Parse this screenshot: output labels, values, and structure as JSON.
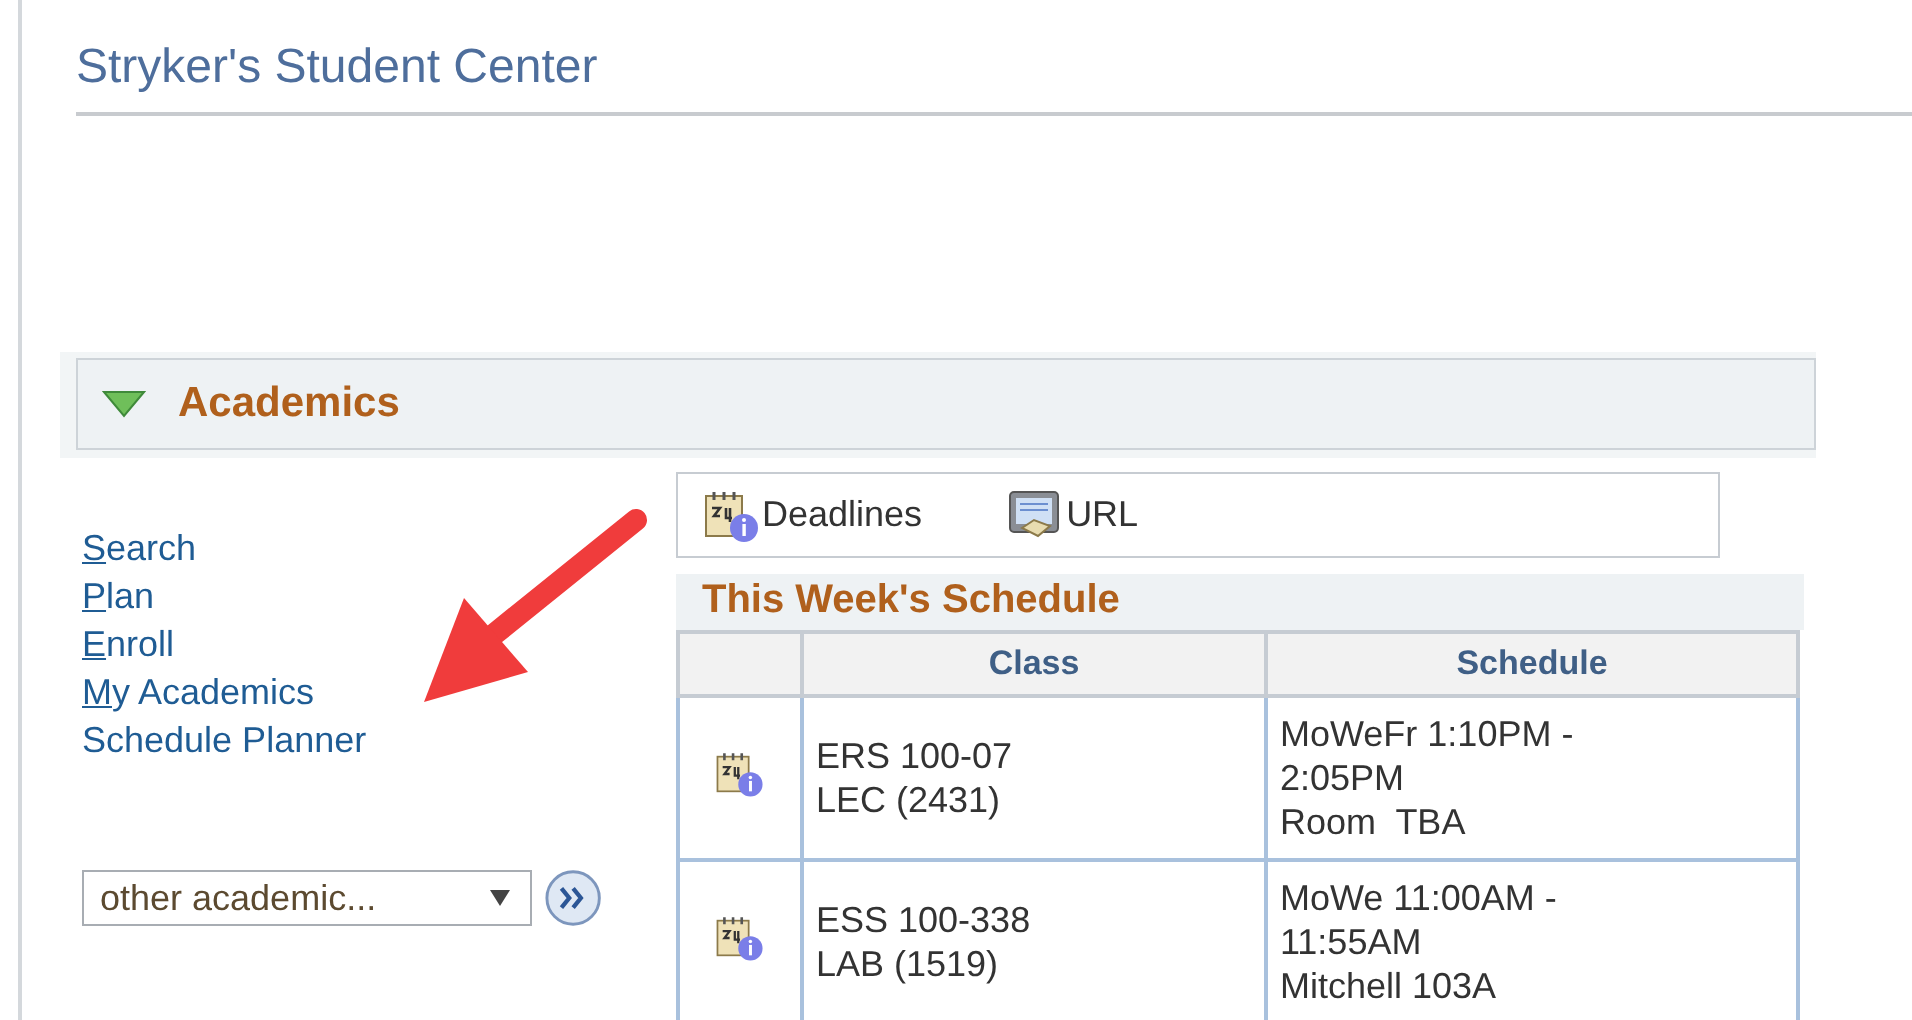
{
  "page": {
    "title": "Stryker's Student Center"
  },
  "section": {
    "title": "Academics",
    "expanded": true
  },
  "links": [
    {
      "label": "Search",
      "access_key": true
    },
    {
      "label": "Plan",
      "access_key": true
    },
    {
      "label": "Enroll",
      "access_key": true
    },
    {
      "label": "My Academics",
      "access_key": true
    },
    {
      "label": "Schedule Planner",
      "access_key": false
    }
  ],
  "dropdown": {
    "value": "other academic..."
  },
  "quick_links": [
    {
      "label": "Deadlines",
      "kind": "calendar"
    },
    {
      "label": "URL",
      "kind": "screen"
    }
  ],
  "schedule": {
    "title": "This Week's Schedule",
    "columns": [
      "Class",
      "Schedule"
    ],
    "rows": [
      {
        "class": [
          "ERS 100-07",
          "LEC (2431)"
        ],
        "schedule": [
          "MoWeFr 1:10PM -",
          "2:05PM",
          "Room  TBA"
        ]
      },
      {
        "class": [
          "ESS 100-338",
          "LAB (1519)"
        ],
        "schedule": [
          "MoWe 11:00AM -",
          "11:55AM",
          "Mitchell 103A"
        ]
      }
    ]
  }
}
